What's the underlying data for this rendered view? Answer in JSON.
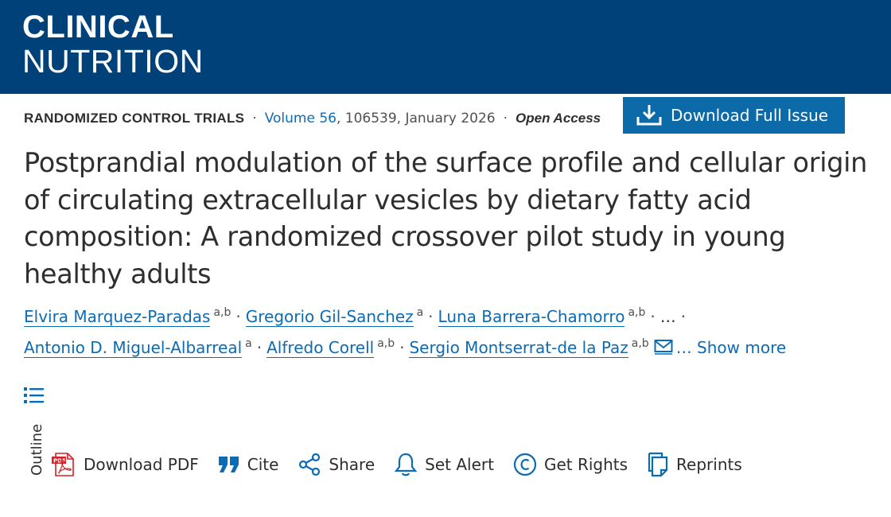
{
  "journal": {
    "title_line1": "CLINICAL",
    "title_line2": "NUTRITION"
  },
  "meta": {
    "article_type": "RANDOMIZED CONTROL TRIALS",
    "separator": "·",
    "volume_link": "Volume 56",
    "pub_info": ", 106539, January 2026",
    "access": "Open Access"
  },
  "download_issue": {
    "label": "Download Full Issue",
    "icon": "download-icon"
  },
  "article": {
    "title": "Postprandial modulation of the surface profile and cellular origin of circulating extracellular vesicles by dietary fatty acid composition: A randomized crossover pilot study in young healthy adults"
  },
  "authors": {
    "list": [
      {
        "name": "Elvira Marquez-Paradas",
        "aff": "a,b"
      },
      {
        "name": "Gregorio Gil-Sanchez",
        "aff": "a"
      },
      {
        "name": "Luna Barrera-Chamorro",
        "aff": "a,b"
      },
      {
        "name": "Antonio D. Miguel-Albarreal",
        "aff": "a"
      },
      {
        "name": "Alfredo Corell",
        "aff": "a,b"
      },
      {
        "name": "Sergio Montserrat-de la Paz",
        "aff": "a,b"
      }
    ],
    "ellipsis": "…",
    "separator": "·",
    "show_more": "… Show more",
    "corresponding_icon": "envelope-icon"
  },
  "outline": {
    "label": "Outline",
    "icon": "list-icon"
  },
  "toolbar": {
    "download_pdf": "Download PDF",
    "cite": "Cite",
    "share": "Share",
    "set_alert": "Set Alert",
    "get_rights": "Get Rights",
    "reprints": "Reprints"
  },
  "colors": {
    "masthead": "#00417a",
    "link": "#0c6bb5",
    "button": "#0c6aa8",
    "pdf_red": "#d02227"
  }
}
